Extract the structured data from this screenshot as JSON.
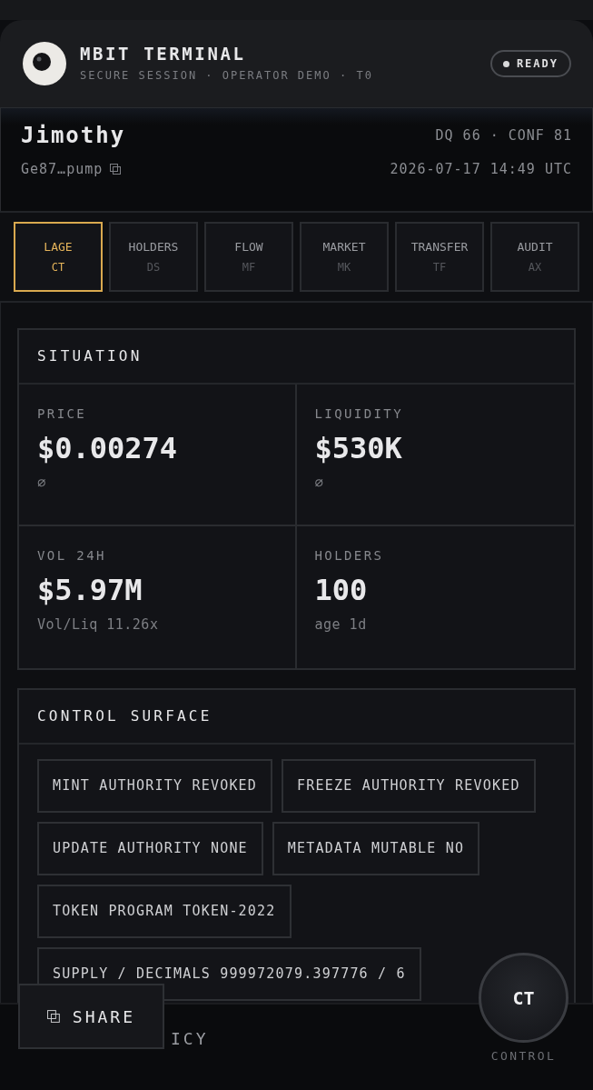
{
  "header": {
    "title": "MBIT TERMINAL",
    "subtitle": "SECURE SESSION · OPERATOR DEMO · T0",
    "status": "READY"
  },
  "token": {
    "name": "Jimothy",
    "address": "Ge87…pump",
    "scores": "DQ 66 · CONF 81",
    "timestamp": "2026-07-17 14:49 UTC"
  },
  "tabs": [
    {
      "label": "LAGE",
      "code": "CT",
      "selected": true
    },
    {
      "label": "HOLDERS",
      "code": "DS",
      "selected": false
    },
    {
      "label": "FLOW",
      "code": "MF",
      "selected": false
    },
    {
      "label": "MARKET",
      "code": "MK",
      "selected": false
    },
    {
      "label": "TRANSFER",
      "code": "TF",
      "selected": false
    },
    {
      "label": "AUDIT",
      "code": "AX",
      "selected": false
    }
  ],
  "situation": {
    "title": "SITUATION",
    "metrics": [
      {
        "label": "PRICE",
        "value": "$0.00274",
        "note": "∅"
      },
      {
        "label": "LIQUIDITY",
        "value": "$530K",
        "note": "∅"
      },
      {
        "label": "VOL 24H",
        "value": "$5.97M",
        "note": "Vol/Liq 11.26x"
      },
      {
        "label": "HOLDERS",
        "value": "100",
        "note": "age 1d"
      }
    ]
  },
  "control_surface": {
    "title": "CONTROL SURFACE",
    "chips": [
      "MINT AUTHORITY REVOKED",
      "FREEZE AUTHORITY REVOKED",
      "UPDATE AUTHORITY NONE",
      "METADATA MUTABLE NO",
      "TOKEN PROGRAM TOKEN-2022",
      "SUPPLY / DECIMALS 999972079.397776 / 6"
    ]
  },
  "footer": {
    "text": "ICY"
  },
  "share": {
    "label": "SHARE"
  },
  "fab": {
    "label": "CT",
    "caption": "CONTROL"
  }
}
